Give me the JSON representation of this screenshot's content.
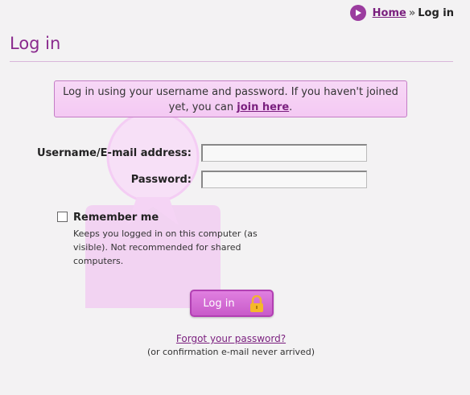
{
  "breadcrumb": {
    "home": "Home",
    "separator": "»",
    "current": "Log in"
  },
  "page": {
    "title": "Log in"
  },
  "notice": {
    "text_before": "Log in using your username and password. If you haven't joined yet, you can ",
    "link": "join here",
    "text_after": "."
  },
  "form": {
    "username_label": "Username/E-mail address:",
    "username_value": "",
    "password_label": "Password:",
    "password_value": "",
    "remember_label": "Remember me",
    "remember_checked": false,
    "remember_description": "Keeps you logged in on this computer (as visible). Not recommended for shared computers.",
    "login_button": "Log in"
  },
  "links": {
    "forgot": "Forgot your password?",
    "confirmation_note": "(or confirmation e-mail never arrived)"
  },
  "colors": {
    "accent": "#8a2a8e",
    "button": "#d06dd1",
    "notice_bg": "#f6d2f5"
  },
  "icons": {
    "breadcrumb": "play-circle-icon",
    "button": "lock-icon",
    "background": "user-silhouette-icon"
  }
}
